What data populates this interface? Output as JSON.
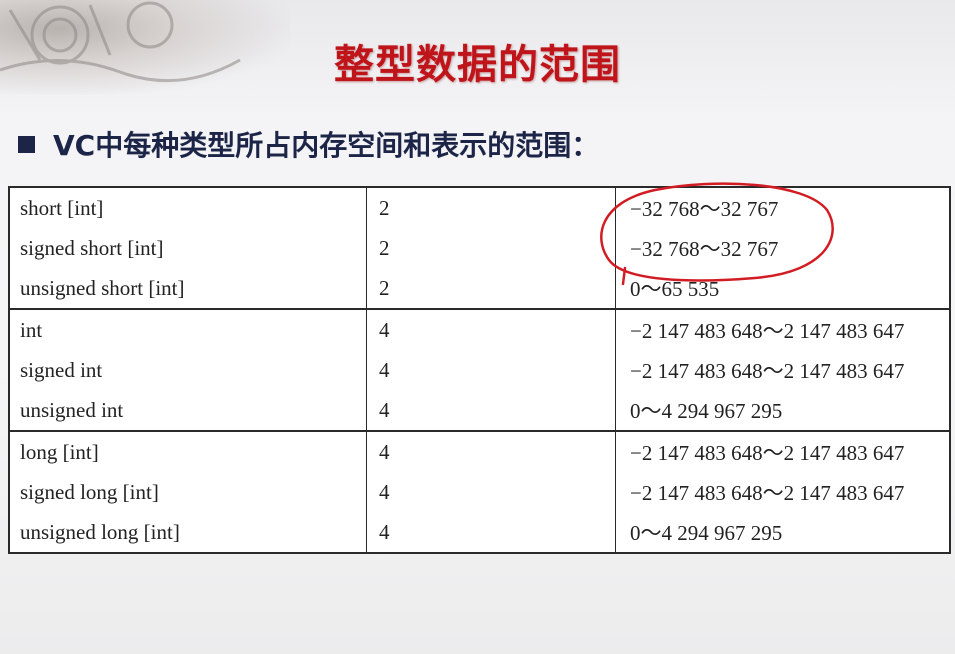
{
  "slide": {
    "title": "整型数据的范围",
    "bullet_text": "VC中每种类型所占内存空间和表示的范围："
  },
  "table": {
    "groups": [
      {
        "rows": [
          {
            "type": "short [int]",
            "bytes": "2",
            "range": "−32 768～32 767"
          },
          {
            "type": "signed short [int]",
            "bytes": "2",
            "range": "−32 768～32 767"
          },
          {
            "type": "unsigned short [int]",
            "bytes": "2",
            "range": "0～65 535"
          }
        ]
      },
      {
        "rows": [
          {
            "type": "int",
            "bytes": "4",
            "range": "−2 147 483 648～2 147 483 647"
          },
          {
            "type": "signed int",
            "bytes": "4",
            "range": "−2 147 483 648～2 147 483 647"
          },
          {
            "type": "unsigned int",
            "bytes": "4",
            "range": "0～4 294 967 295"
          }
        ]
      },
      {
        "rows": [
          {
            "type": "long [int]",
            "bytes": "4",
            "range": "−2 147 483 648～2 147 483 647"
          },
          {
            "type": "signed long [int]",
            "bytes": "4",
            "range": "−2 147 483 648～2 147 483 647"
          },
          {
            "type": "unsigned long [int]",
            "bytes": "4",
            "range": "0～4 294 967 295"
          }
        ]
      }
    ]
  },
  "colors": {
    "title": "#c0141b",
    "bullet_text": "#1c2547",
    "annotation": "#d21c24"
  }
}
